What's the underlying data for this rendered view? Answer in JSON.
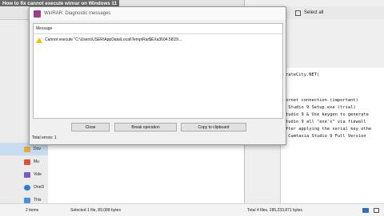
{
  "video_title": "How to fix cannot execute winrar on Windows 11",
  "dialog": {
    "title": "WinRAR: Diagnostic messages",
    "column_header": "Message",
    "message": "Cannot execute \"C:\\Users\\USER\\AppData\\Local\\Temp\\Rar$EXa3604.5815\\...",
    "buttons": [
      "Close",
      "Break operation",
      "Copy to clipboard"
    ],
    "total_errors": "Total errors: 1"
  },
  "right_window": {
    "select_all": "Select all",
    "notepad_lines": [
      "rateCity.NET)",
      "",
      "",
      "ernet connection (important)",
      " Studio 9 Setup.exe (trial)",
      "tudio 9 & Use keygen to generate",
      "tudio 9 all \"exe's\" via fiewall",
      "fter applying the serial key othe",
      " Camtasia Studio 9 Full Version"
    ]
  },
  "left_nav": {
    "items": [
      "Dov",
      "Mu",
      "Vide",
      "OneD",
      "This"
    ]
  },
  "status_left": {
    "items_count": "2 items",
    "selected": "Selected 1 file, 89,088 bytes"
  },
  "status_right": {
    "total": "Total 4 files, 285,233,871 bytes"
  },
  "colors": {
    "titlebar_accent": "#7a3fb0",
    "warning": "#f2c200",
    "nav_selected": "#c8ddf0"
  }
}
